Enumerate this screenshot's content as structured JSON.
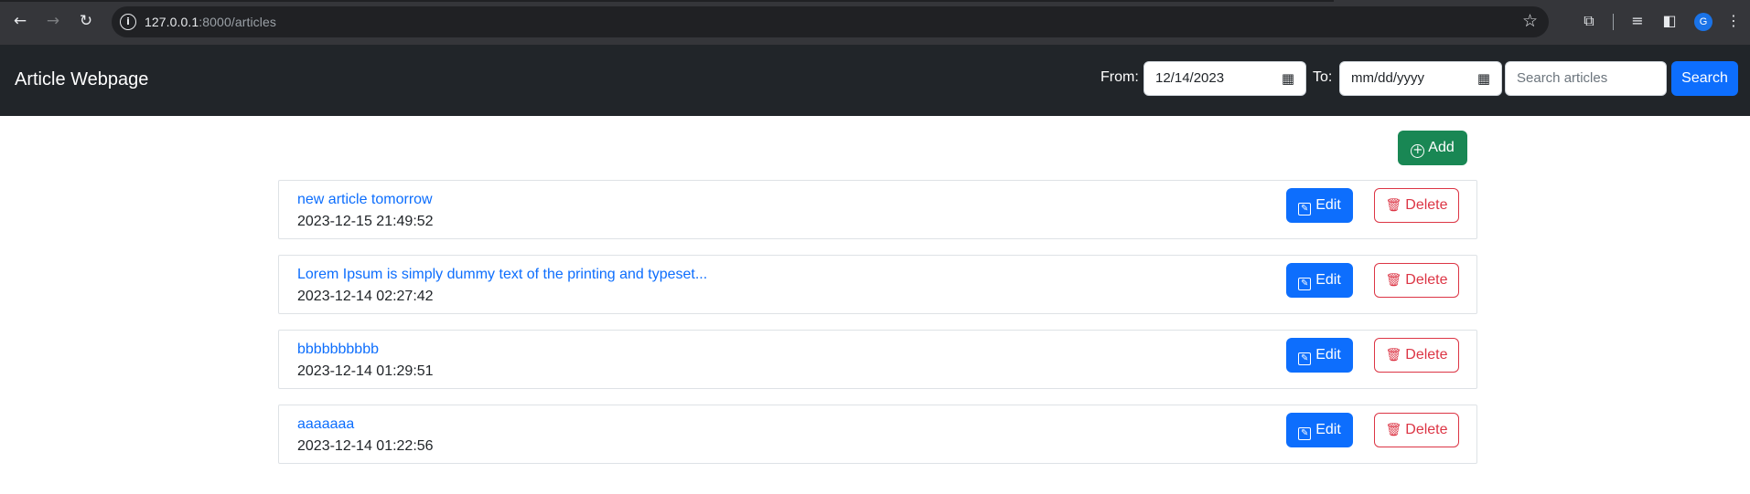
{
  "browser": {
    "url_host": "127.0.0.1",
    "url_path": ":8000/articles"
  },
  "navbar": {
    "brand": "Article Webpage",
    "from_label": "From:",
    "from_value": "12/14/2023",
    "to_label": "To:",
    "to_placeholder": "mm/dd/yyyy",
    "search_placeholder": "Search articles",
    "search_button": "Search"
  },
  "add_button": "Add",
  "articles": [
    {
      "title": "new article tomorrow",
      "time": "2023-12-15 21:49:52",
      "edit": "Edit",
      "delete": "Delete"
    },
    {
      "title": "Lorem Ipsum is simply dummy text of the printing and typeset...",
      "time": "2023-12-14 02:27:42",
      "edit": "Edit",
      "delete": "Delete"
    },
    {
      "title": "bbbbbbbbbb",
      "time": "2023-12-14 01:29:51",
      "edit": "Edit",
      "delete": "Delete"
    },
    {
      "title": "aaaaaaa",
      "time": "2023-12-14 01:22:56",
      "edit": "Edit",
      "delete": "Delete"
    }
  ],
  "colors": {
    "navbar_bg": "#212529",
    "primary": "#0d6efd",
    "success": "#198754",
    "danger": "#dc3545"
  },
  "icons": {
    "back": "back-arrow-icon",
    "forward": "forward-arrow-icon",
    "reload": "reload-icon",
    "info": "info-icon",
    "star": "bookmark-star-icon",
    "calendar": "calendar-icon",
    "add": "plus-circle-icon",
    "edit": "pencil-square-icon",
    "delete": "trash-icon"
  }
}
